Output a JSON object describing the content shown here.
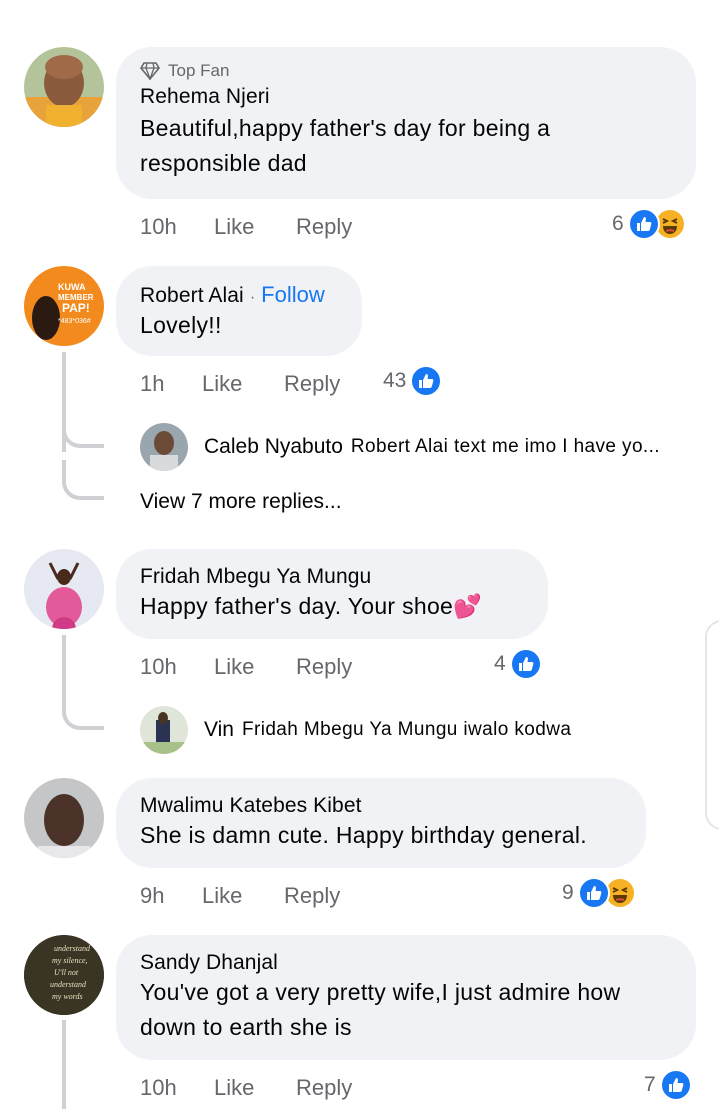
{
  "comments": [
    {
      "badge": "Top Fan",
      "author": "Rehema Njeri",
      "text": "Beautiful,happy father's day for being a responsible dad",
      "time": "10h",
      "like": "Like",
      "reply": "Reply",
      "reaction_count": "6",
      "reactions": [
        "like-icon",
        "haha-icon"
      ]
    },
    {
      "author": "Robert Alai",
      "follow": "Follow",
      "separator": "·",
      "text": "Lovely!!",
      "time": "1h",
      "like": "Like",
      "reply": "Reply",
      "reaction_count": "43",
      "reactions": [
        "like-icon"
      ],
      "reply_preview": {
        "author": "Caleb Nyabuto",
        "text": "Robert Alai text me imo I have yo..."
      },
      "more_replies": "View 7 more replies..."
    },
    {
      "author": "Fridah Mbegu Ya Mungu",
      "text": "Happy father's day. Your shoe💕",
      "time": "10h",
      "like": "Like",
      "reply": "Reply",
      "reaction_count": "4",
      "reactions": [
        "like-icon"
      ],
      "reply_preview": {
        "author": "Vin",
        "text": "Fridah Mbegu Ya Mungu iwalo kodwa"
      }
    },
    {
      "author": "Mwalimu Katebes Kibet",
      "text": "She is damn cute. Happy birthday general.",
      "time": "9h",
      "like": "Like",
      "reply": "Reply",
      "reaction_count": "9",
      "reactions": [
        "like-icon",
        "haha-icon"
      ]
    },
    {
      "author": "Sandy Dhanjal",
      "text": "You've got a very pretty wife,I just admire how down to earth she is",
      "time": "10h",
      "like": "Like",
      "reply": "Reply",
      "reaction_count": "7",
      "reactions": [
        "like-icon"
      ],
      "avatar_text": "understand my silence, U'll not understand my words"
    }
  ],
  "robert_avatar_text": "KUWA MEMBER PAP! *483*036#",
  "colors": {
    "link": "#1877f2",
    "bubble": "#f0f2f5",
    "meta": "#65676b",
    "like": "#1877f2",
    "haha": "#f7b125",
    "thread": "#ced0d4"
  }
}
